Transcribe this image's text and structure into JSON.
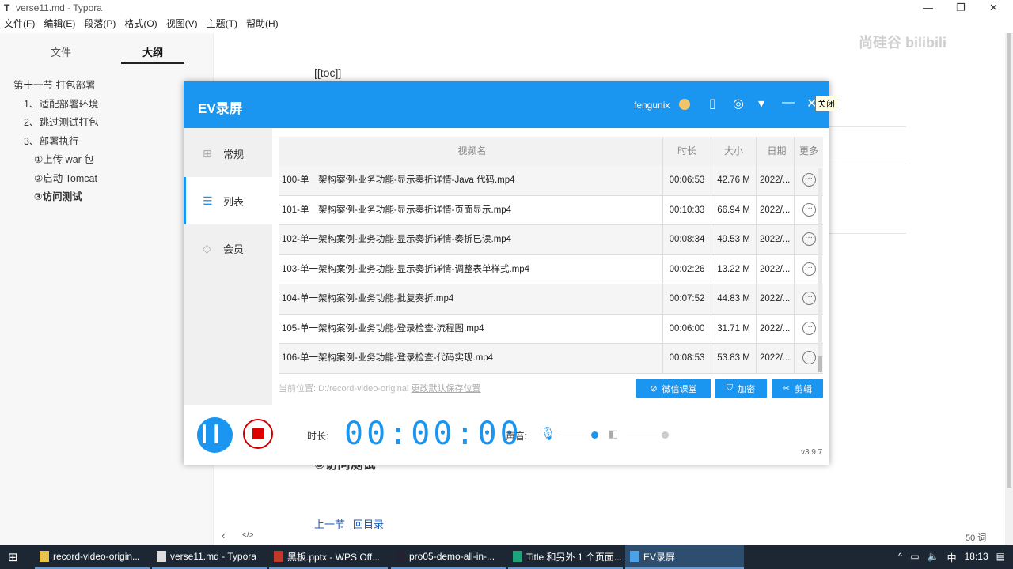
{
  "typora": {
    "icon": "T",
    "title": "verse11.md - Typora",
    "menu": [
      "文件(F)",
      "编辑(E)",
      "段落(P)",
      "格式(O)",
      "视图(V)",
      "主题(T)",
      "帮助(H)"
    ],
    "sidebar_tabs": [
      "文件",
      "大纲"
    ],
    "outline": [
      "第十一节 打包部署",
      "1、适配部署环境",
      "2、跳过测试打包",
      "3、部署执行",
      "①上传 war 包",
      "②启动 Tomcat",
      "③访问测试"
    ],
    "editor": {
      "toc": "[[toc]]",
      "heading_partial": "③访问测试",
      "prev": "上一节",
      "back": "回目录",
      "word_count": "50 词"
    },
    "watermark": "尚硅谷 bilibili"
  },
  "ev": {
    "title": "EV录屏",
    "user": "fengunix",
    "tooltip": "关闭",
    "nav": [
      "常规",
      "列表",
      "会员"
    ],
    "columns": [
      "视频名",
      "时长",
      "大小",
      "日期",
      "更多"
    ],
    "rows": [
      {
        "name": "100-单一架构案例-业务功能-显示奏折详情-Java 代码.mp4",
        "dur": "00:06:53",
        "size": "42.76 M",
        "date": "2022/..."
      },
      {
        "name": "101-单一架构案例-业务功能-显示奏折详情-页面显示.mp4",
        "dur": "00:10:33",
        "size": "66.94 M",
        "date": "2022/..."
      },
      {
        "name": "102-单一架构案例-业务功能-显示奏折详情-奏折已读.mp4",
        "dur": "00:08:34",
        "size": "49.53 M",
        "date": "2022/..."
      },
      {
        "name": "103-单一架构案例-业务功能-显示奏折详情-调整表单样式.mp4",
        "dur": "00:02:26",
        "size": "13.22 M",
        "date": "2022/..."
      },
      {
        "name": "104-单一架构案例-业务功能-批复奏折.mp4",
        "dur": "00:07:52",
        "size": "44.83 M",
        "date": "2022/..."
      },
      {
        "name": "105-单一架构案例-业务功能-登录检查-流程图.mp4",
        "dur": "00:06:00",
        "size": "31.71 M",
        "date": "2022/..."
      },
      {
        "name": "106-单一架构案例-业务功能-登录检查-代码实现.mp4",
        "dur": "00:08:53",
        "size": "53.83 M",
        "date": "2022/..."
      }
    ],
    "location_label": "当前位置:",
    "location": "D:/record-video-original",
    "change_location": "更改默认保存位置",
    "buttons": [
      "微信课堂",
      "加密",
      "剪辑"
    ],
    "duration_label": "时长:",
    "timer": "00:00:00",
    "sound_label": "声音:",
    "mic_level": 1.0,
    "speaker_level": 1.0,
    "version": "v3.9.7"
  },
  "taskbar": {
    "tasks": [
      "record-video-origin...",
      "verse11.md - Typora",
      "黑板.pptx - WPS Off...",
      "pro05-demo-all-in-...",
      "Title 和另外 1 个页面...",
      "EV录屏"
    ],
    "tray": {
      "ime": "中",
      "time": "18:13"
    }
  },
  "colors": {
    "accent": "#1a96f0",
    "stop": "#d00000"
  }
}
